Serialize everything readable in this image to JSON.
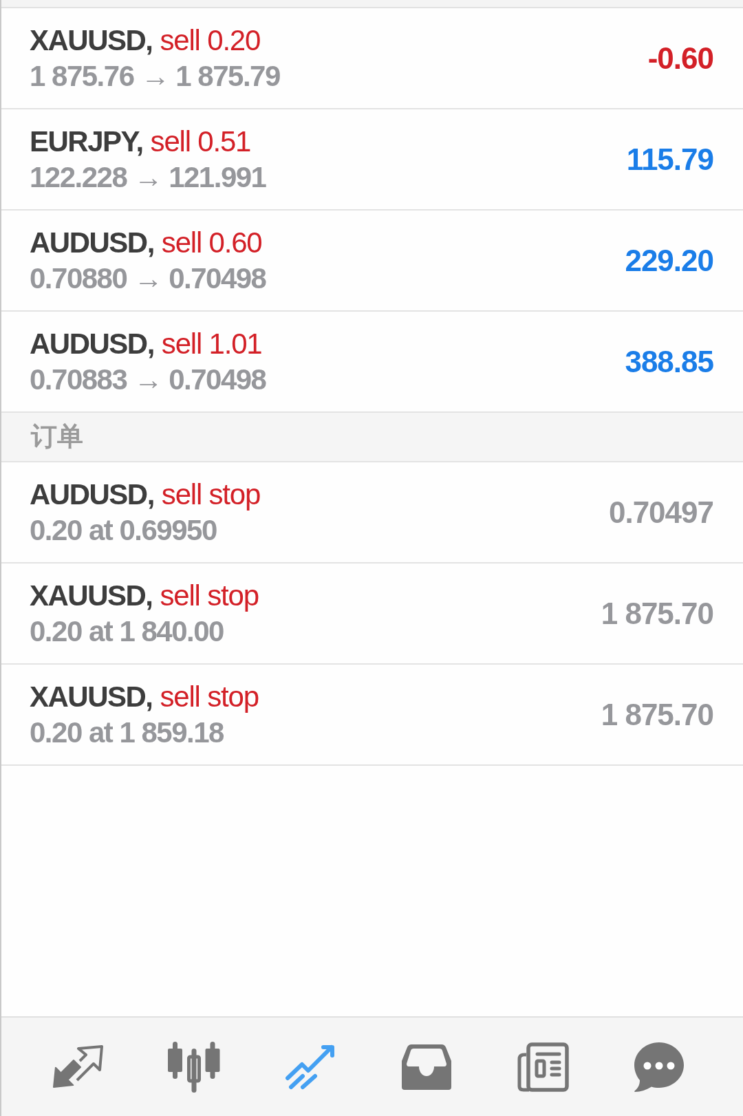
{
  "positions": [
    {
      "symbol": "XAUUSD,",
      "type": "sell 0.20",
      "prices": "1 875.76 → 1 875.79",
      "profit": "-0.60",
      "color": "#d32027"
    },
    {
      "symbol": "EURJPY,",
      "type": "sell 0.51",
      "prices": "122.228 → 121.991",
      "profit": "115.79",
      "color": "#1a7de8"
    },
    {
      "symbol": "AUDUSD,",
      "type": "sell 0.60",
      "prices": "0.70880 → 0.70498",
      "profit": "229.20",
      "color": "#1a7de8"
    },
    {
      "symbol": "AUDUSD,",
      "type": "sell 1.01",
      "prices": "0.70883 → 0.70498",
      "profit": "388.85",
      "color": "#1a7de8"
    }
  ],
  "orders_section": {
    "title": "订单"
  },
  "orders": [
    {
      "symbol": "AUDUSD,",
      "type": "sell stop",
      "detail": "0.20 at 0.69950",
      "price": "0.70497"
    },
    {
      "symbol": "XAUUSD,",
      "type": "sell stop",
      "detail": "0.20 at 1 840.00",
      "price": "1 875.70"
    },
    {
      "symbol": "XAUUSD,",
      "type": "sell stop",
      "detail": "0.20 at 1 859.18",
      "price": "1 875.70"
    }
  ],
  "nav": [
    {
      "selected": false
    },
    {
      "selected": false
    },
    {
      "selected": true
    },
    {
      "selected": false
    },
    {
      "selected": false
    },
    {
      "selected": false
    }
  ]
}
